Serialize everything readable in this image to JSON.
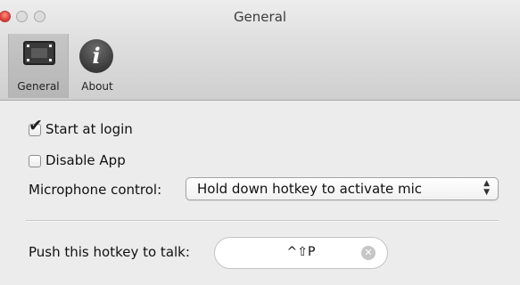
{
  "window": {
    "title": "General"
  },
  "toolbar": {
    "items": [
      {
        "label": "General",
        "icon": "general-prefs-icon",
        "selected": true
      },
      {
        "label": "About",
        "icon": "info-icon",
        "selected": false
      }
    ],
    "about_glyph": "i"
  },
  "settings": {
    "start_at_login": {
      "label": "Start at login",
      "checked": true
    },
    "disable_app": {
      "label": "Disable App",
      "checked": false
    },
    "microphone_control": {
      "label": "Microphone control:",
      "selected": "Hold down hotkey to activate mic"
    },
    "hotkey": {
      "label": "Push this hotkey to talk:",
      "value": "^⇧P"
    }
  },
  "colors": {
    "close_button": "#e0443a",
    "window_bg": "#ececec"
  }
}
